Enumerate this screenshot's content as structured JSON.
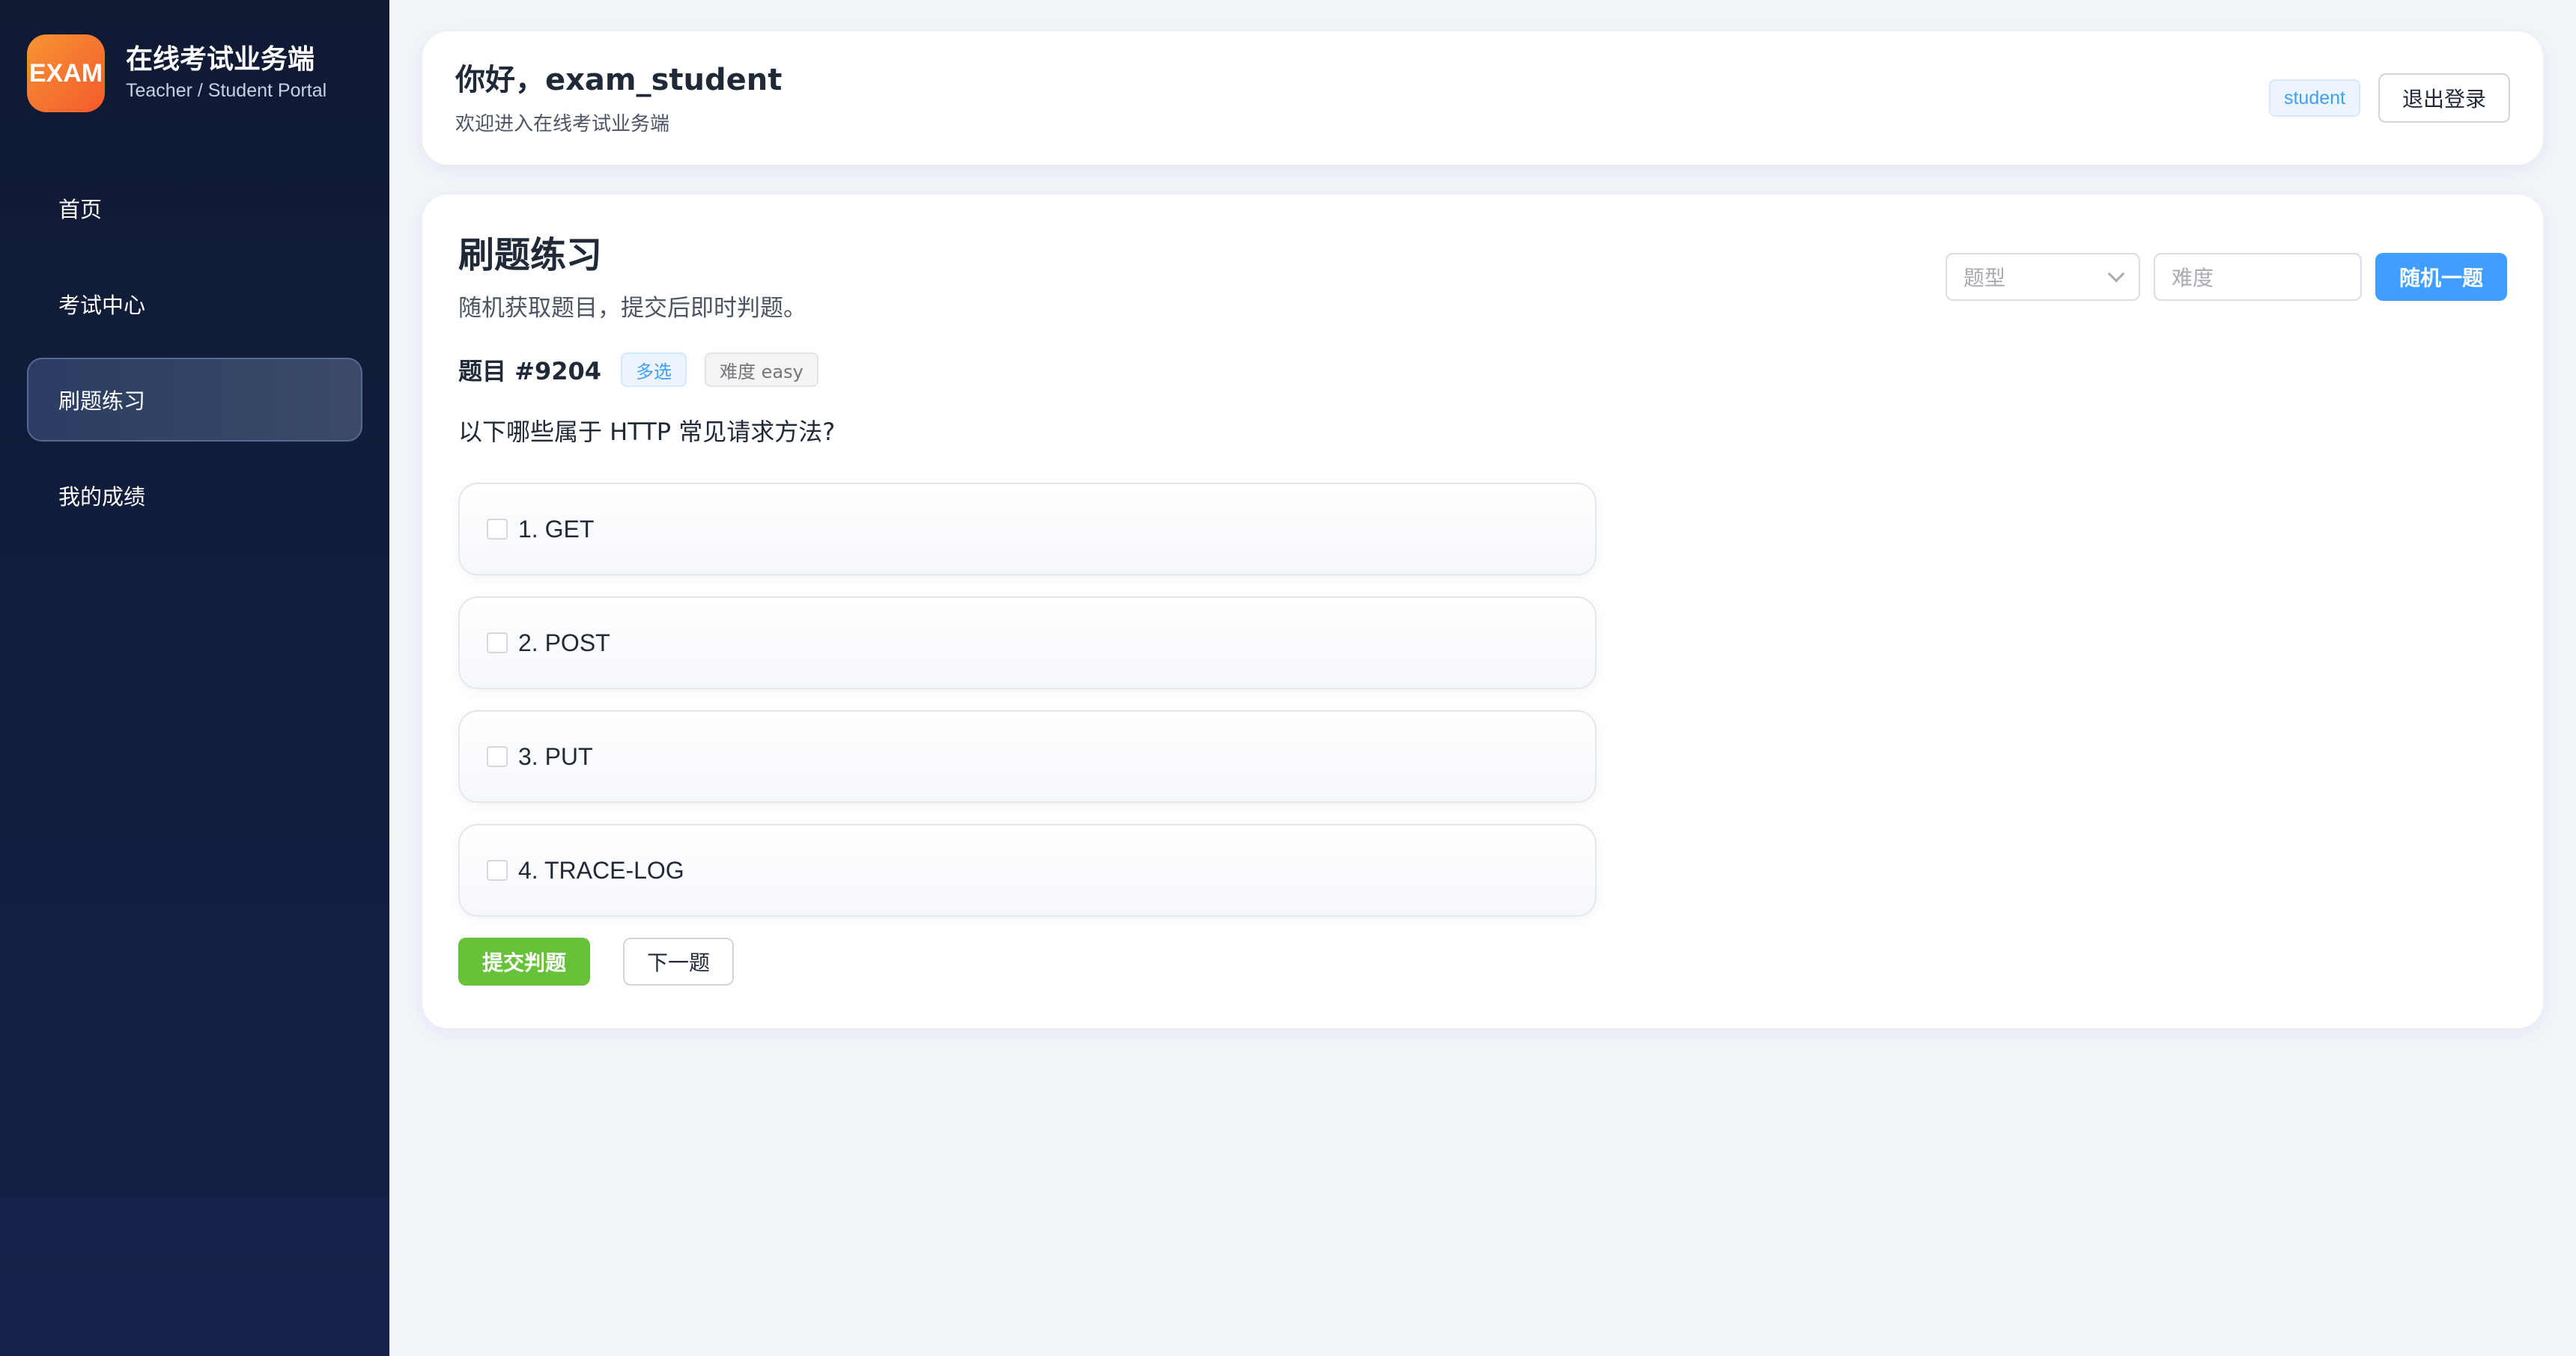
{
  "brand": {
    "logo_text": "EXAM",
    "title": "在线考试业务端",
    "subtitle": "Teacher / Student Portal"
  },
  "sidebar": {
    "items": [
      {
        "label": "首页",
        "active": false
      },
      {
        "label": "考试中心",
        "active": false
      },
      {
        "label": "刷题练习",
        "active": true
      },
      {
        "label": "我的成绩",
        "active": false
      }
    ]
  },
  "header": {
    "greeting": "你好，exam_student",
    "subtitle": "欢迎进入在线考试业务端",
    "role_tag": "student",
    "logout_label": "退出登录"
  },
  "practice": {
    "title": "刷题练习",
    "subtitle": "随机获取题目，提交后即时判题。",
    "filters": {
      "type_placeholder": "题型",
      "difficulty_placeholder": "难度",
      "random_label": "随机一题"
    },
    "question": {
      "id_label": "题目 #9204",
      "type_tag": "多选",
      "difficulty_tag": "难度 easy",
      "text": "以下哪些属于 HTTP 常见请求方法?",
      "options": [
        {
          "label": "1. GET",
          "checked": false
        },
        {
          "label": "2. POST",
          "checked": false
        },
        {
          "label": "3. PUT",
          "checked": false
        },
        {
          "label": "4. TRACE-LOG",
          "checked": false
        }
      ]
    },
    "actions": {
      "submit_label": "提交判题",
      "next_label": "下一题"
    }
  },
  "colors": {
    "sidebar_bg": "#101a33",
    "primary": "#409eff",
    "success": "#67c23a",
    "logo_orange": "#f5702e"
  }
}
